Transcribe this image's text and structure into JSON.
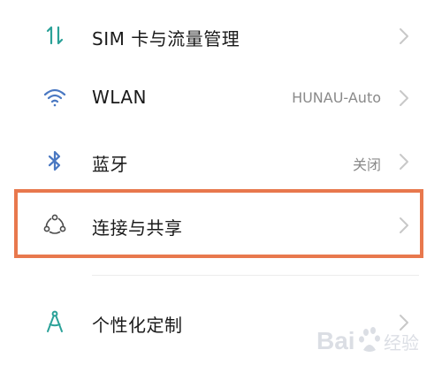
{
  "colors": {
    "icon_teal": "#2aa198",
    "icon_blue": "#4a78c2",
    "highlight_border": "#e8784d",
    "label_text": "#1a1a1a",
    "value_text": "#8a8a8a",
    "chevron": "#c8c8c8"
  },
  "settings": {
    "items": [
      {
        "icon": "sim-data-arrows-icon",
        "label": "SIM 卡与流量管理",
        "value": ""
      },
      {
        "icon": "wifi-icon",
        "label": "WLAN",
        "value": "HUNAU-Auto"
      },
      {
        "icon": "bluetooth-icon",
        "label": "蓝牙",
        "value": "关闭"
      },
      {
        "icon": "connection-share-icon",
        "label": "连接与共享",
        "value": ""
      },
      {
        "icon": "personalization-icon",
        "label": "个性化定制",
        "value": ""
      }
    ]
  },
  "watermark": {
    "logo_icon": "baidu-paw-icon",
    "text_latin": "Bai",
    "text_tail": "经验"
  }
}
